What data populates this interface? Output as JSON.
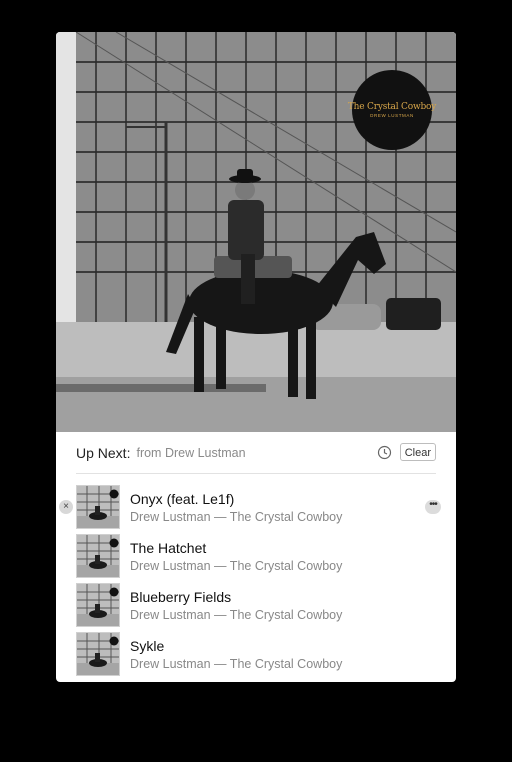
{
  "album_art": {
    "badge_title": "The Crystal Cowboy",
    "badge_artist": "DREW LUSTMAN"
  },
  "header": {
    "up_next_label": "Up Next:",
    "source": "from Drew Lustman",
    "history_icon": "clock-icon",
    "clear_label": "Clear"
  },
  "tracks": [
    {
      "title": "Onyx (feat. Le1f)",
      "subtitle": "Drew Lustman — The Crystal Cowboy"
    },
    {
      "title": "The Hatchet",
      "subtitle": "Drew Lustman — The Crystal Cowboy"
    },
    {
      "title": "Blueberry Fields",
      "subtitle": "Drew Lustman — The Crystal Cowboy"
    },
    {
      "title": "Sykle",
      "subtitle": "Drew Lustman — The Crystal Cowboy"
    }
  ],
  "row_controls": {
    "remove_icon": "close-icon",
    "remove_glyph": "×",
    "more_icon": "ellipsis-icon",
    "more_glyph": "•••"
  }
}
